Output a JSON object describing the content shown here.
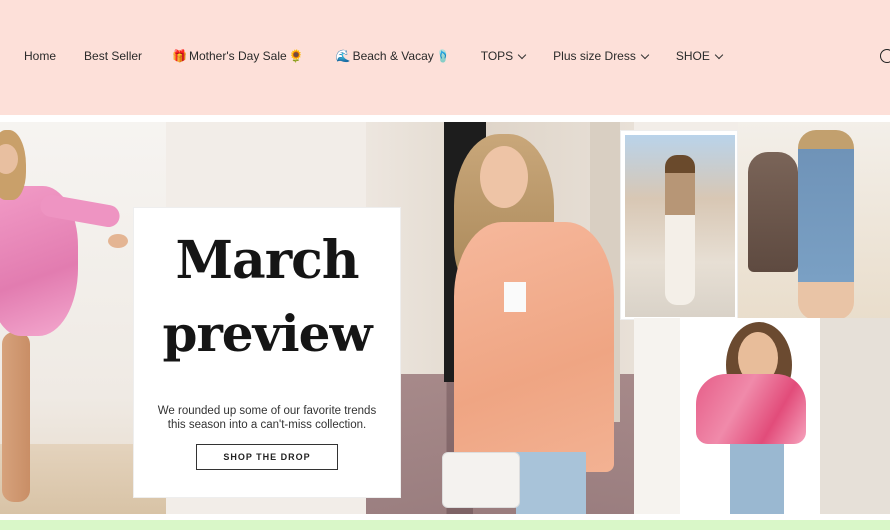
{
  "nav": {
    "items": [
      {
        "label": "Home",
        "has_dropdown": false,
        "emoji_before": "",
        "emoji_after": ""
      },
      {
        "label": "Best Seller",
        "has_dropdown": false,
        "emoji_before": "",
        "emoji_after": ""
      },
      {
        "label": "Mother's Day Sale",
        "has_dropdown": false,
        "emoji_before": "🎁",
        "emoji_after": "🌻"
      },
      {
        "label": "Beach & Vacay",
        "has_dropdown": false,
        "emoji_before": "🌊",
        "emoji_after": "🩴"
      },
      {
        "label": "TOPS",
        "has_dropdown": true,
        "emoji_before": "",
        "emoji_after": ""
      },
      {
        "label": "Plus size Dress",
        "has_dropdown": true,
        "emoji_before": "",
        "emoji_after": ""
      },
      {
        "label": "SHOE",
        "has_dropdown": true,
        "emoji_before": "",
        "emoji_after": ""
      }
    ],
    "search_icon": "search-icon"
  },
  "hero": {
    "title_line1": "March",
    "title_line2": "preview",
    "subtitle": "We rounded up some of our favorite trends this season into a can't-miss collection.",
    "cta_label": "SHOP THE DROP"
  },
  "colors": {
    "header_bg": "#fde0d9",
    "bottom_strip": "#d9f7c8"
  }
}
